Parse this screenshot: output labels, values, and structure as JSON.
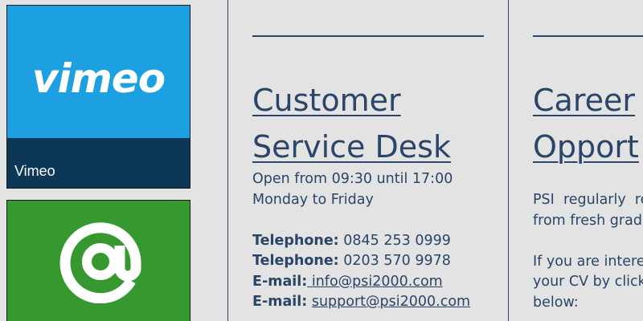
{
  "tiles": {
    "vimeo": {
      "caption": "Vimeo",
      "logo_text": "vimeo",
      "icon": "vimeo-logo",
      "color": "#1ca0e2",
      "caption_bar_color": "#0c3757"
    },
    "email": {
      "icon": "at-sign-icon",
      "color": "#35992f"
    }
  },
  "customer_service": {
    "title_line1": "Customer",
    "title_line2": "Service Desk",
    "hours_line1": "Open from 09:30 until 17:00",
    "hours_line2": "Monday to Friday",
    "contacts": [
      {
        "label": "Telephone:",
        "value": "0845 253 0999"
      },
      {
        "label": "Telephone:",
        "value": "0203 570 9978"
      },
      {
        "label": "E-mail:",
        "value": " info@psi2000.com"
      },
      {
        "label": "E-mail:",
        "value": "support@psi2000.com"
      }
    ]
  },
  "careers": {
    "title_line1": "Career",
    "title_line2": "Opport",
    "para1_line1": "PSI  regularly  re",
    "para1_line2": "from fresh gradu",
    "para2_line1": "If you are intere",
    "para2_line2": "your CV by click",
    "para2_line3": "below:"
  },
  "colors": {
    "background": "#e3e3e3",
    "text": "#2a4568"
  }
}
